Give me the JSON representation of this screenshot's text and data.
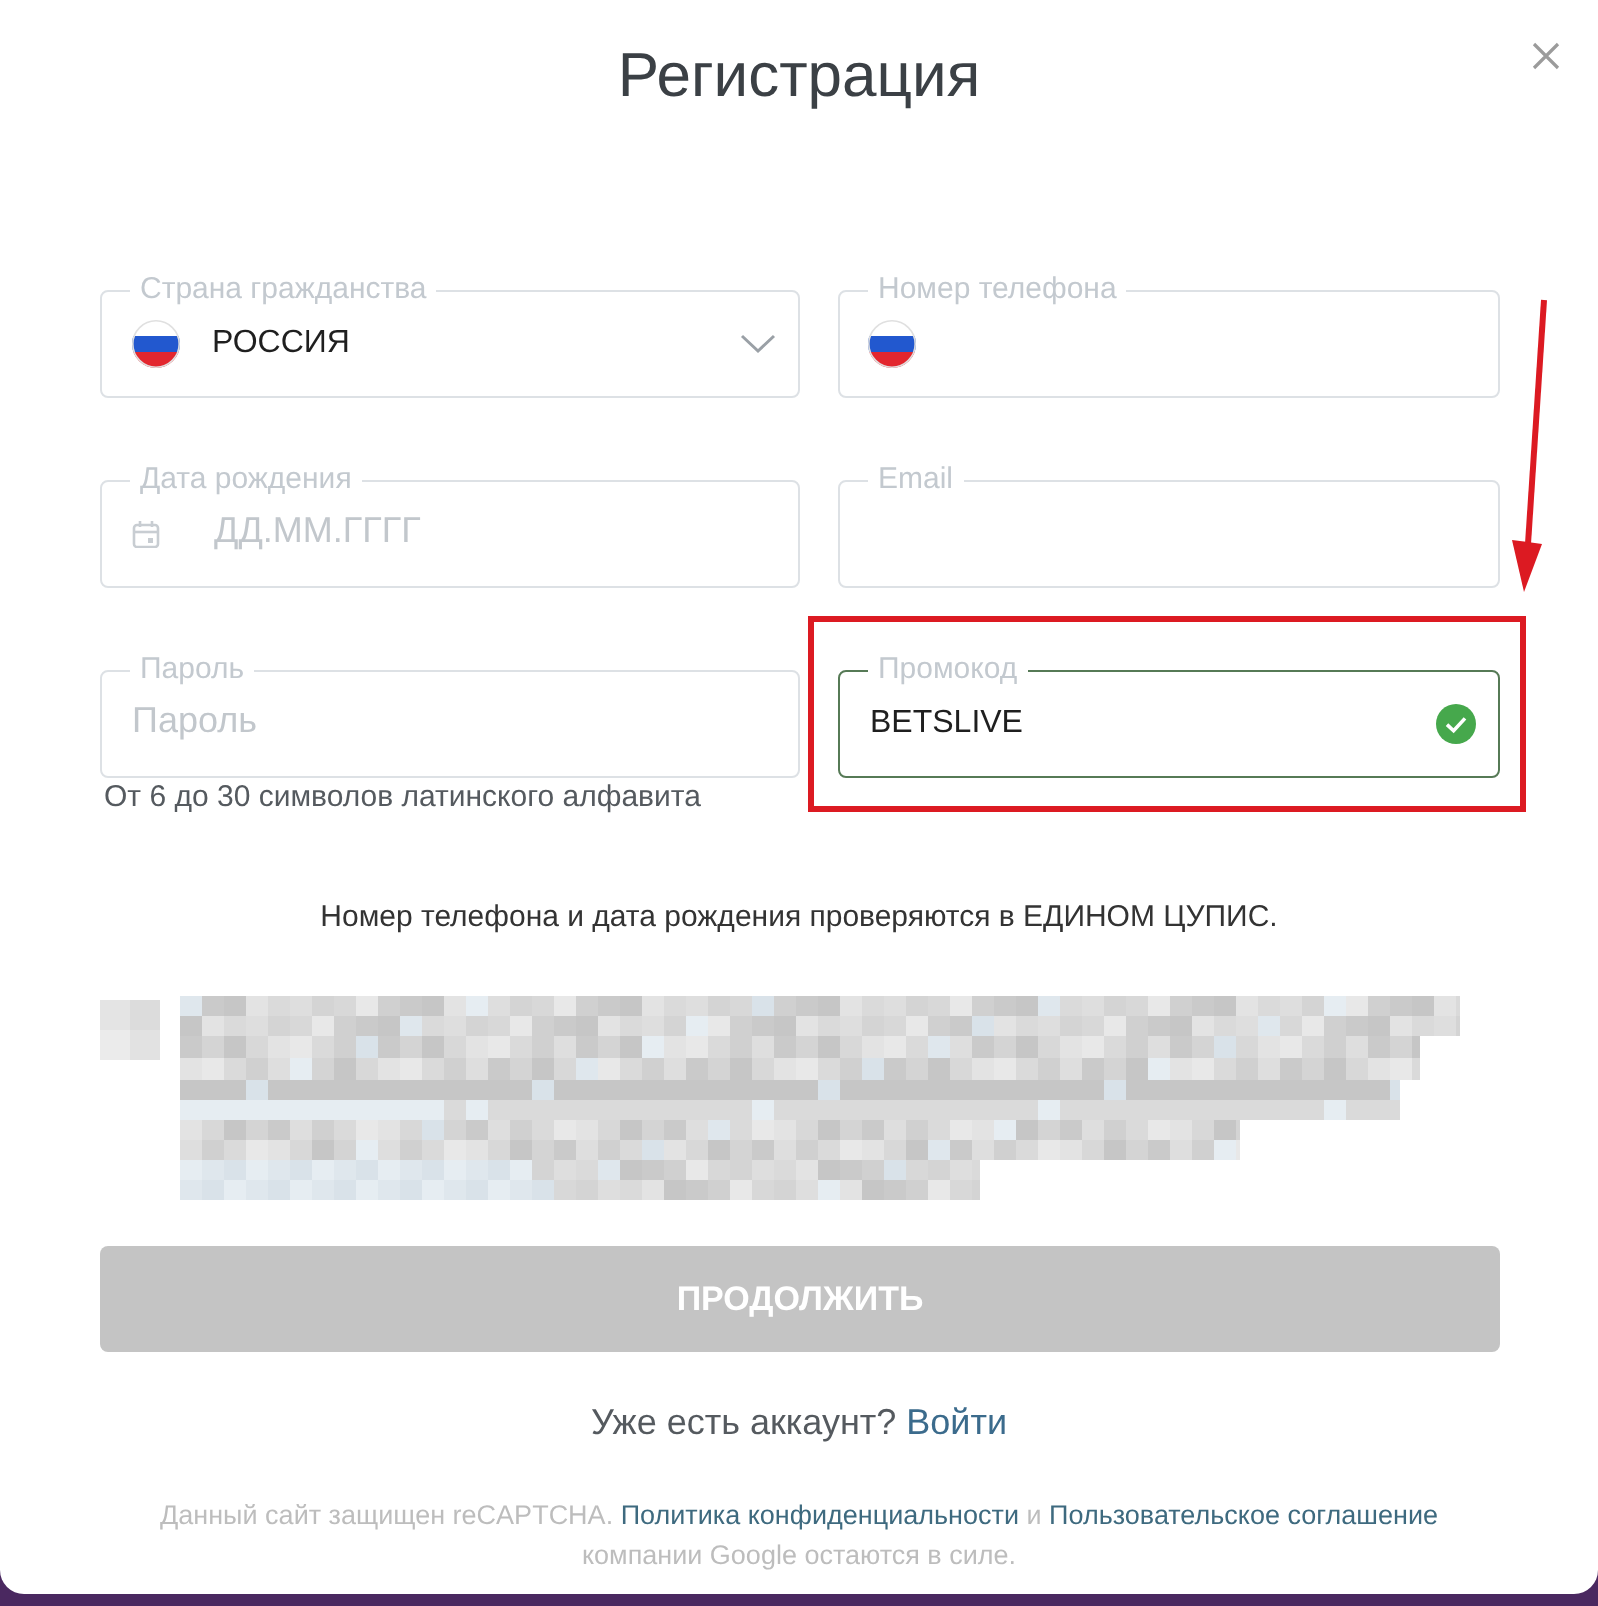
{
  "dialog": {
    "title": "Регистрация"
  },
  "fields": [
    {
      "kind": "select",
      "label": "Страна гражданства",
      "value": "РОССИЯ",
      "valid": false,
      "highlighted": false
    },
    {
      "kind": "phone",
      "label": "Номер телефона",
      "valid": false,
      "highlighted": false
    },
    {
      "kind": "date",
      "label": "Дата рождения",
      "placeholder": "ДД.ММ.ГГГГ",
      "valid": false,
      "highlighted": false
    },
    {
      "kind": "email",
      "label": "Email",
      "valid": false,
      "highlighted": false
    },
    {
      "kind": "password",
      "label": "Пароль",
      "placeholder": "Пароль",
      "hint": "От 6 до 30 символов латинского алфавита",
      "valid": false,
      "highlighted": false
    },
    {
      "kind": "text",
      "label": "Промокод",
      "value": "BETSLIVE",
      "valid": true,
      "highlighted": true
    }
  ],
  "notice": "Номер телефона и дата рождения проверяются в ЕДИНОМ ЦУПИС.",
  "submit_button": {
    "label": "ПРОДОЛЖИТЬ",
    "disabled": true
  },
  "login_prompt": {
    "text": "Уже есть аккаунт?",
    "link": "Войти"
  },
  "recaptcha_notice": [
    {
      "kind": "text",
      "text": "Данный сайт защищен reCAPTCHA. "
    },
    {
      "kind": "link",
      "text": "Политика конфиденциальности"
    },
    {
      "kind": "text",
      "text": " и "
    },
    {
      "kind": "link",
      "text": "Пользовательское соглашение"
    },
    {
      "kind": "text",
      "text": " компании Google остаются в силе."
    }
  ]
}
